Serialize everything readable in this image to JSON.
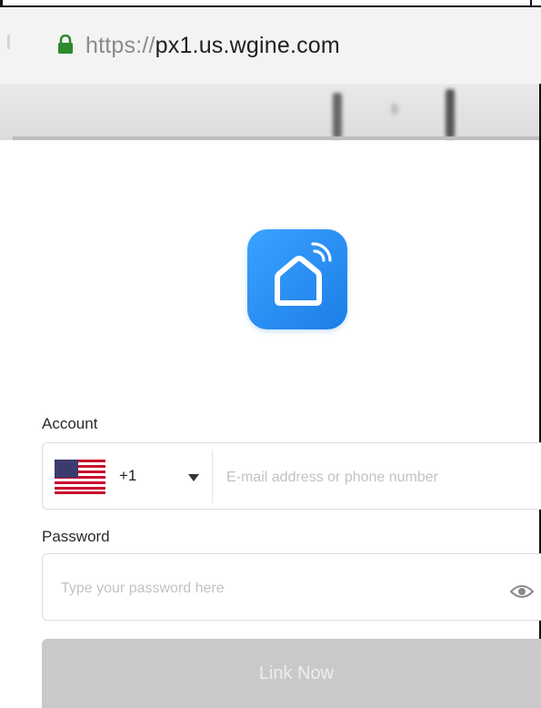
{
  "browser": {
    "url_scheme": "https://",
    "url_host": "px1.us.wgine.com",
    "lock_icon": "lock-icon"
  },
  "colors": {
    "lock_green": "#2e8b2e",
    "logo_blue": "#2a8ff5",
    "button_disabled": "#c9c9c9"
  },
  "logo": {
    "icon": "smart-home-icon"
  },
  "form": {
    "account_label": "Account",
    "country_code": "+1",
    "country_flag": "us-flag-icon",
    "account_placeholder": "E-mail address or phone number",
    "password_label": "Password",
    "password_placeholder": "Type your password here",
    "show_password_icon": "eye-icon",
    "submit_label": "Link Now"
  }
}
